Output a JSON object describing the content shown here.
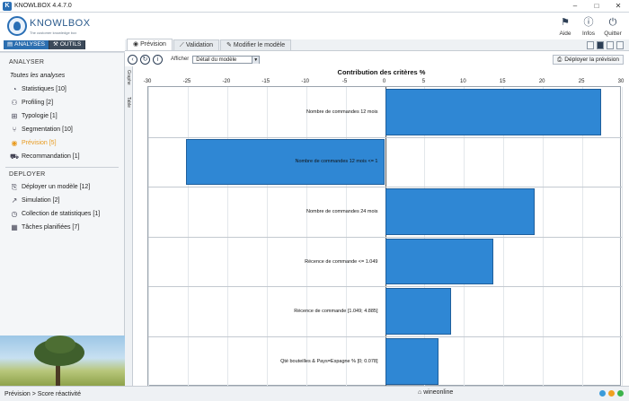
{
  "window": {
    "title": "KNOWLBOX 4.4.7.0"
  },
  "brand": {
    "name": "KNOWLBOX",
    "tagline": "The customer knowledge box"
  },
  "modes": [
    {
      "label": "ANALYSES"
    },
    {
      "label": "OUTILS"
    }
  ],
  "top_actions": [
    {
      "label": "Aide"
    },
    {
      "label": "Infos"
    },
    {
      "label": "Quitter"
    }
  ],
  "sidebar": {
    "sections": [
      {
        "title": "ANALYSER",
        "items": [
          {
            "label": "Toutes les analyses"
          },
          {
            "label": "Statistiques [10]"
          },
          {
            "label": "Profiling [2]"
          },
          {
            "label": "Typologie [1]"
          },
          {
            "label": "Segmentation [10]"
          },
          {
            "label": "Prévision [5]"
          },
          {
            "label": "Recommandation [1]"
          }
        ]
      },
      {
        "title": "DEPLOYER",
        "items": [
          {
            "label": "Déployer un modèle [12]"
          },
          {
            "label": "Simulation [2]"
          },
          {
            "label": "Collection de statistiques [1]"
          },
          {
            "label": "Tâches planifiées [7]"
          }
        ]
      }
    ]
  },
  "tabs": [
    {
      "label": "Prévision"
    },
    {
      "label": "Validation"
    },
    {
      "label": "Modifier le modèle"
    }
  ],
  "toolbar": {
    "show_label": "Afficher",
    "select_value": "Détail du modèle",
    "deploy_label": "Déployer la prévision"
  },
  "vertical_tabs": [
    {
      "label": "Graphe"
    },
    {
      "label": "Table"
    }
  ],
  "chart_data": {
    "type": "bar",
    "orientation": "horizontal",
    "title": "Contribution des critères   %",
    "xlim": [
      -30,
      30
    ],
    "xticks": [
      -30,
      -25,
      -20,
      -15,
      -10,
      -5,
      0,
      5,
      10,
      15,
      20,
      25,
      30
    ],
    "categories": [
      "Nombre de commandes 12 mois",
      "Nombre de commandes 12 mois <= 1",
      "Nombre de commandes 24 mois",
      "Récence de commande <= 1.049",
      "Récence de commande [1.049; 4.885]",
      "Qté bouteilles & Pays=Espagne % [0; 0.078]"
    ],
    "values": [
      27.4,
      -25.2,
      18.9,
      13.7,
      8.4,
      6.8
    ],
    "color": "#2f87d4",
    "grid": true
  },
  "status": {
    "breadcrumb": "Prévision > Score réactivité",
    "database": "wineonline",
    "indicator_colors": [
      "#3b9bd9",
      "#f0a020",
      "#3cb34a"
    ]
  }
}
